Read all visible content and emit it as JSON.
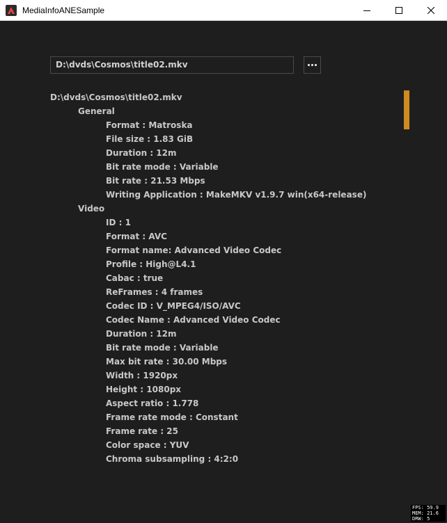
{
  "window": {
    "title": "MediaInfoANESample",
    "icon": "app-logo-icon"
  },
  "toolbar": {
    "path_value": "D:\\dvds\\Cosmos\\title02.mkv",
    "browse_icon": "ellipsis-icon"
  },
  "info": {
    "file_path": "D:\\dvds\\Cosmos\\title02.mkv",
    "general_header": "General",
    "general": [
      "Format : Matroska",
      "File size : 1.83 GiB",
      "Duration : 12m",
      "Bit rate mode : Variable",
      "Bit rate : 21.53 Mbps",
      "Writing Application : MakeMKV v1.9.7 win(x64-release)"
    ],
    "video_header": "Video",
    "video": [
      "ID : 1",
      "Format : AVC",
      "Format name: Advanced Video Codec",
      "Profile : High@L4.1",
      "Cabac : true",
      "ReFrames : 4 frames",
      "Codec ID : V_MPEG4/ISO/AVC",
      "Codec Name : Advanced Video Codec",
      "Duration : 12m",
      "Bit rate mode : Variable",
      "Max bit rate : 30.00 Mbps",
      "Width : 1920px",
      "Height : 1080px",
      "Aspect ratio : 1.778",
      "Frame rate mode : Constant",
      "Frame rate : 25",
      "Color space : YUV",
      "Chroma subsampling : 4:2:0"
    ]
  },
  "stats": {
    "fps": "FPS: 59.9",
    "mem": "MEM: 21.6",
    "drw": "DRW: 5"
  },
  "colors": {
    "background": "#1e1e1e",
    "text": "#c8c8c8",
    "accent": "#d08a20"
  }
}
